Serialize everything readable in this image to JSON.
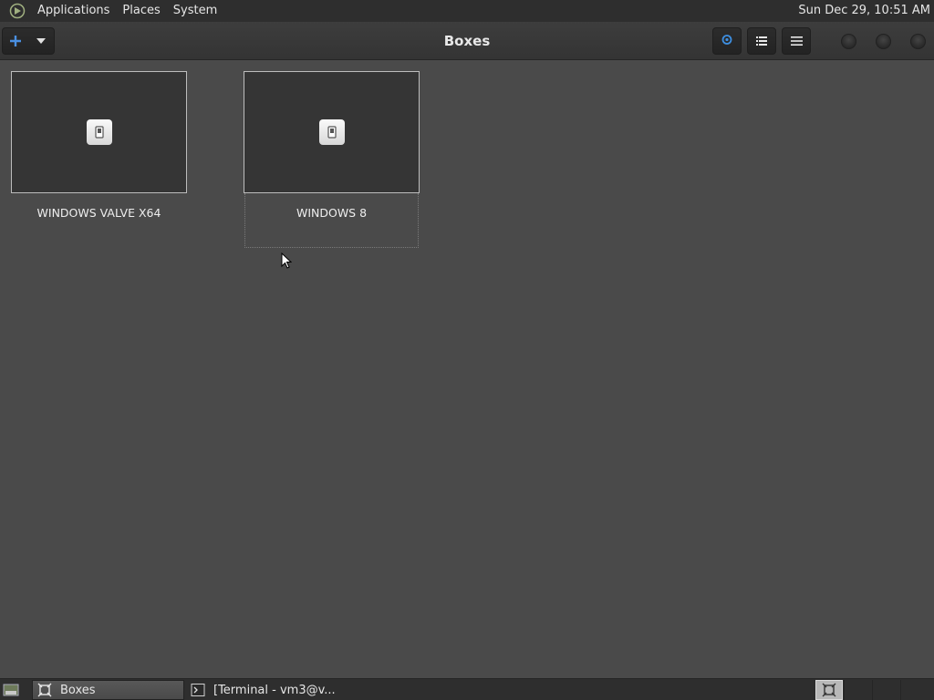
{
  "top_panel": {
    "menus": [
      "Applications",
      "Places",
      "System"
    ],
    "clock": "Sun Dec 29, 10:51 AM",
    "logo_icon": "gnome-foot-logo"
  },
  "headerbar": {
    "title": "Boxes",
    "new_icon": "plus-icon",
    "dropdown_icon": "caret-down-icon",
    "buttons": [
      "search-icon",
      "list-view-icon",
      "menu-icon"
    ],
    "window_controls": [
      "minimize",
      "maximize",
      "close"
    ]
  },
  "boxes": [
    {
      "name": "WINDOWS VALVE X64",
      "icon": "power-switch-icon"
    },
    {
      "name": "WINDOWS 8",
      "icon": "power-switch-icon",
      "focused": true
    }
  ],
  "taskbar": {
    "items": [
      {
        "label": "Boxes",
        "icon": "boxes-icon",
        "active": true
      },
      {
        "label": "[Terminal - vm3@v...",
        "icon": "terminal-icon",
        "active": false
      }
    ],
    "workspaces": 4
  },
  "colors": {
    "background": "#4a4a4a",
    "panel": "#2e2e2e",
    "accent": "#3d8ee0"
  }
}
